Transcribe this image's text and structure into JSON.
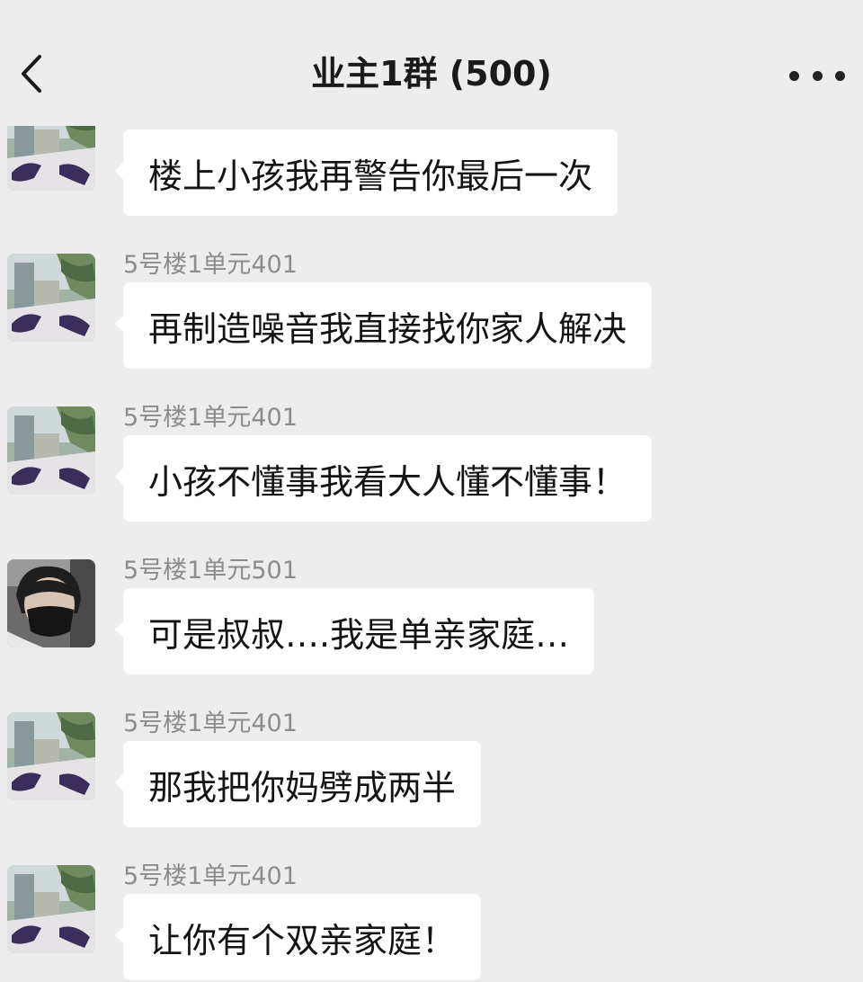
{
  "header": {
    "title": "业主1群 (500)"
  },
  "messages": [
    {
      "sender": "",
      "text": "楼上小孩我再警告你最后一次",
      "avatar": "garden-avatar"
    },
    {
      "sender": "5号楼1单元401",
      "text": "再制造噪音我直接找你家人解决",
      "avatar": "garden-avatar"
    },
    {
      "sender": "5号楼1单元401",
      "text": "小孩不懂事我看大人懂不懂事！",
      "avatar": "garden-avatar"
    },
    {
      "sender": "5号楼1单元501",
      "text": "可是叔叔….我是单亲家庭…",
      "avatar": "masked-person-avatar"
    },
    {
      "sender": "5号楼1单元401",
      "text": "那我把你妈劈成两半",
      "avatar": "garden-avatar"
    },
    {
      "sender": "5号楼1单元401",
      "text": "让你有个双亲家庭！",
      "avatar": "garden-avatar"
    }
  ],
  "icons": {
    "back": "chevron-left-icon",
    "more": "more-dots-icon"
  },
  "colors": {
    "background": "#ededed",
    "bubble": "#ffffff",
    "sender_text": "#8c8c8c"
  }
}
